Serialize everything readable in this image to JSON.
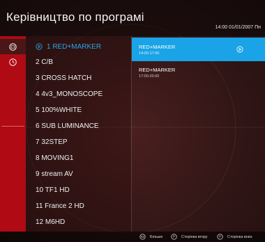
{
  "header": {
    "title": "Керівництво по програмі",
    "clock": "14:00 01/01/2007 Пн"
  },
  "rail": {
    "items": [
      {
        "icon": "channel-list-icon",
        "active": true
      },
      {
        "icon": "clock-icon",
        "active": false
      }
    ]
  },
  "channels": [
    {
      "label": "1 RED+MARKER",
      "selected": true,
      "icon": "play-icon"
    },
    {
      "label": "2 C/B"
    },
    {
      "label": "3 CROSS HATCH"
    },
    {
      "label": "4 4v3_MONOSCOPE"
    },
    {
      "label": "5 100%WHITE"
    },
    {
      "label": "6 SUB LUMINANCE"
    },
    {
      "label": "7 32STEP"
    },
    {
      "label": "8 MOVING1"
    },
    {
      "label": "9 stream AV"
    },
    {
      "label": "10 TF1 HD"
    },
    {
      "label": "11 France 2 HD"
    },
    {
      "label": "12 M6HD"
    }
  ],
  "programs": [
    {
      "title": "RED+MARKER",
      "time": "14:00-17:00",
      "active": true,
      "icon": "play-icon"
    },
    {
      "title": "RED+MARKER",
      "time": "17:00-20:00",
      "active": false
    }
  ],
  "footer": {
    "more": "Більше",
    "page_up": "Сторінка вгору",
    "page_down": "Сторінка вниз"
  },
  "colors": {
    "accent": "#1aa3e6",
    "rail": "#b00a14",
    "selected_text": "#2aa6e8"
  }
}
